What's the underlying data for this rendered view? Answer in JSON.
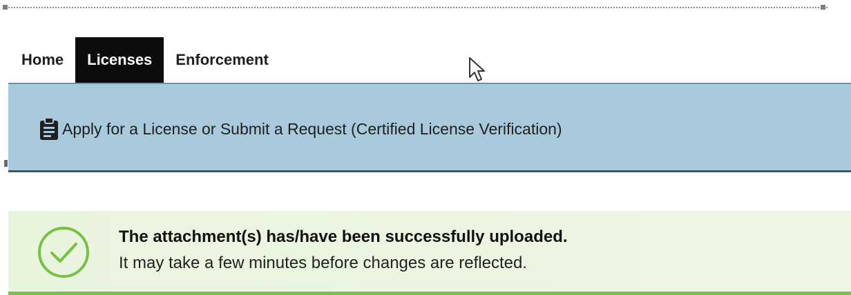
{
  "nav": {
    "tabs": [
      {
        "label": "Home",
        "active": false
      },
      {
        "label": "Licenses",
        "active": true
      },
      {
        "label": "Enforcement",
        "active": false
      }
    ]
  },
  "action": {
    "label": "Apply for a License or Submit a Request (Certified License Verification)",
    "icon": "clipboard-icon"
  },
  "banner": {
    "title": "The attachment(s) has/have been successfully uploaded.",
    "message": "It may take a few minutes before changes are reflected.",
    "icon": "check-circle-icon"
  },
  "colors": {
    "nav_active_bg": "#0d0d0d",
    "action_band_bg": "#a9c9dd",
    "success_bg": "#e9f4dd",
    "success_accent": "#7cc04a"
  }
}
